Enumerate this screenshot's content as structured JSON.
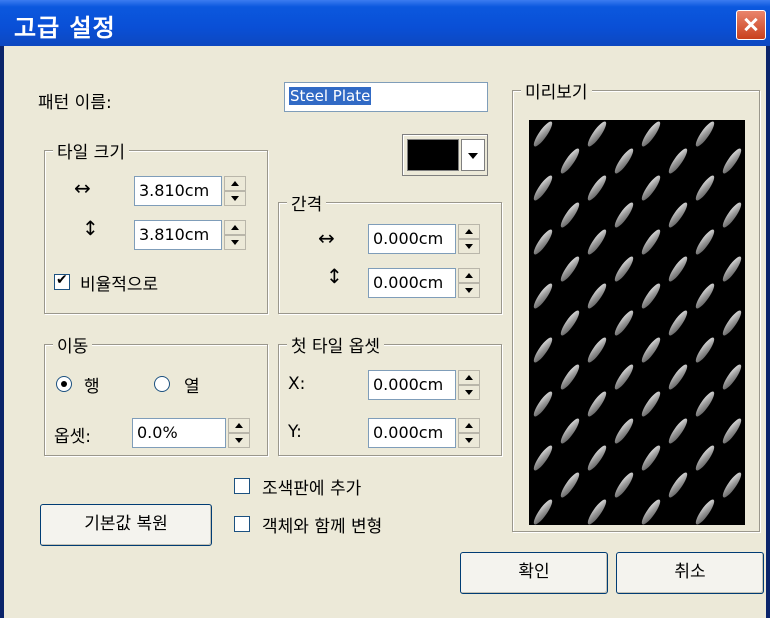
{
  "window": {
    "title": "고급 설정",
    "close_icon": "close-icon"
  },
  "pattern_name": {
    "label": "패턴 이름:",
    "value": "Steel Plate"
  },
  "tile_size": {
    "legend": "타일 크기",
    "width_icon": "horizontal-arrows-icon",
    "height_icon": "vertical-arrows-icon",
    "width": "3.810cm",
    "height": "3.810cm",
    "proportional_label": "비율적으로",
    "proportional_checked": true
  },
  "color_button": {
    "color": "#000000",
    "icon": "chevron-down-icon"
  },
  "spacing": {
    "legend": "간격",
    "horizontal": "0.000cm",
    "vertical": "0.000cm"
  },
  "offset_mode": {
    "legend": "이동",
    "row_label": "행",
    "column_label": "열",
    "selected": "row",
    "offset_label": "옵셋:",
    "offset_value": "0.0%"
  },
  "first_tile_offset": {
    "legend": "첫 타일 옵셋",
    "x_label": "X:",
    "x_value": "0.000cm",
    "y_label": "Y:",
    "y_value": "0.000cm"
  },
  "options": {
    "add_to_swatches": "조색판에 추가",
    "transform_with_object": "객체와 함께 변형"
  },
  "buttons": {
    "reset": "기본값 복원",
    "ok": "확인",
    "cancel": "취소"
  },
  "preview": {
    "legend": "미리보기"
  }
}
